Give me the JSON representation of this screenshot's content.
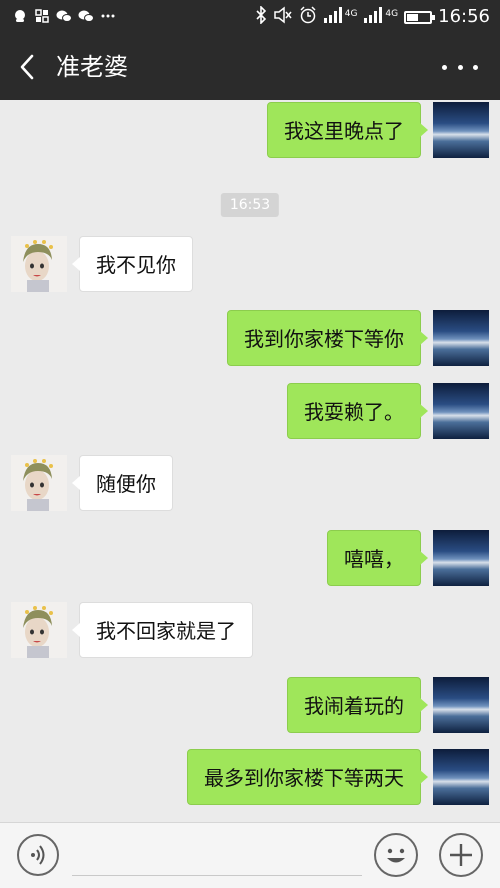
{
  "status_bar": {
    "time": "16:56",
    "network_1": "4G",
    "network_2": "4G",
    "left_icons": [
      "qq-icon",
      "app-grid-icon",
      "wechat-icon",
      "wechat-icon",
      "more-dots-icon"
    ],
    "right_icons": [
      "bluetooth-icon",
      "mute-icon",
      "alarm-icon",
      "signal-icon",
      "signal-icon",
      "battery-icon"
    ]
  },
  "header": {
    "title": "准老婆"
  },
  "messages": [
    {
      "from": "me",
      "text": "我这里晚点了"
    },
    {
      "type": "time",
      "text": "16:53"
    },
    {
      "from": "them",
      "text": "我不见你"
    },
    {
      "from": "me",
      "text": "我到你家楼下等你"
    },
    {
      "from": "me",
      "text": "我耍赖了。"
    },
    {
      "from": "them",
      "text": "随便你"
    },
    {
      "from": "me",
      "text": "嘻嘻，"
    },
    {
      "from": "them",
      "text": "我不回家就是了"
    },
    {
      "from": "me",
      "text": "我闹着玩的"
    },
    {
      "from": "me",
      "text": "最多到你家楼下等两天"
    }
  ],
  "input_bar": {
    "text": "",
    "icons": [
      "voice-icon",
      "emoji-icon",
      "plus-icon"
    ]
  },
  "colors": {
    "top_bar": "#2b2b2b",
    "chat_background": "#ebebeb",
    "my_bubble": "#9fe65a",
    "their_bubble": "#ffffff"
  }
}
